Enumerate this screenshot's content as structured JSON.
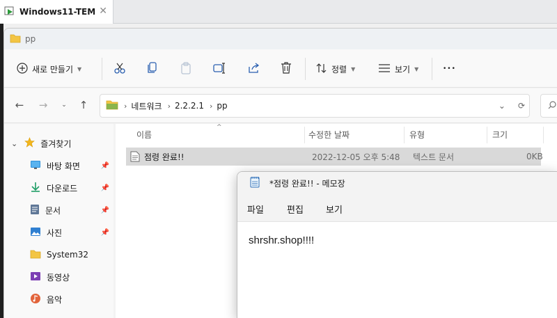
{
  "vm": {
    "tab_label": "Windows11-TEM",
    "close_glyph": "✕"
  },
  "explorer": {
    "title": "pp",
    "toolbar": {
      "new_label": "새로 만들기",
      "sort_label": "정렬",
      "view_label": "보기",
      "more_glyph": "•••"
    },
    "address": {
      "crumbs": [
        "네트워크",
        "2.2.2.1",
        "pp"
      ]
    },
    "nav": {
      "items": [
        {
          "label": "즐겨찾기",
          "icon": "star-icon",
          "pinned": false,
          "expandable": true
        },
        {
          "label": "바탕 화면",
          "icon": "desktop-icon",
          "pinned": true
        },
        {
          "label": "다운로드",
          "icon": "download-icon",
          "pinned": true
        },
        {
          "label": "문서",
          "icon": "document-icon",
          "pinned": true
        },
        {
          "label": "사진",
          "icon": "pictures-icon",
          "pinned": true
        },
        {
          "label": "System32",
          "icon": "folder-icon",
          "pinned": false
        },
        {
          "label": "동영상",
          "icon": "videos-icon",
          "pinned": false
        },
        {
          "label": "음악",
          "icon": "music-icon",
          "pinned": false
        }
      ]
    },
    "columns": {
      "name": "이름",
      "modified": "수정한 날짜",
      "type": "유형",
      "size": "크기"
    },
    "files": [
      {
        "name": "점령 완료!!",
        "modified": "2022-12-05 오후 5:48",
        "type": "텍스트 문서",
        "size": "0KB"
      }
    ]
  },
  "notepad": {
    "title": "*점령 완료!! - 메모장",
    "menu": [
      "파일",
      "편집",
      "보기"
    ],
    "content": "shrshr.shop!!!!"
  },
  "colors": {
    "accent": "#0067c0",
    "selection": "#d9d9d9",
    "folder": "#f3c544"
  }
}
